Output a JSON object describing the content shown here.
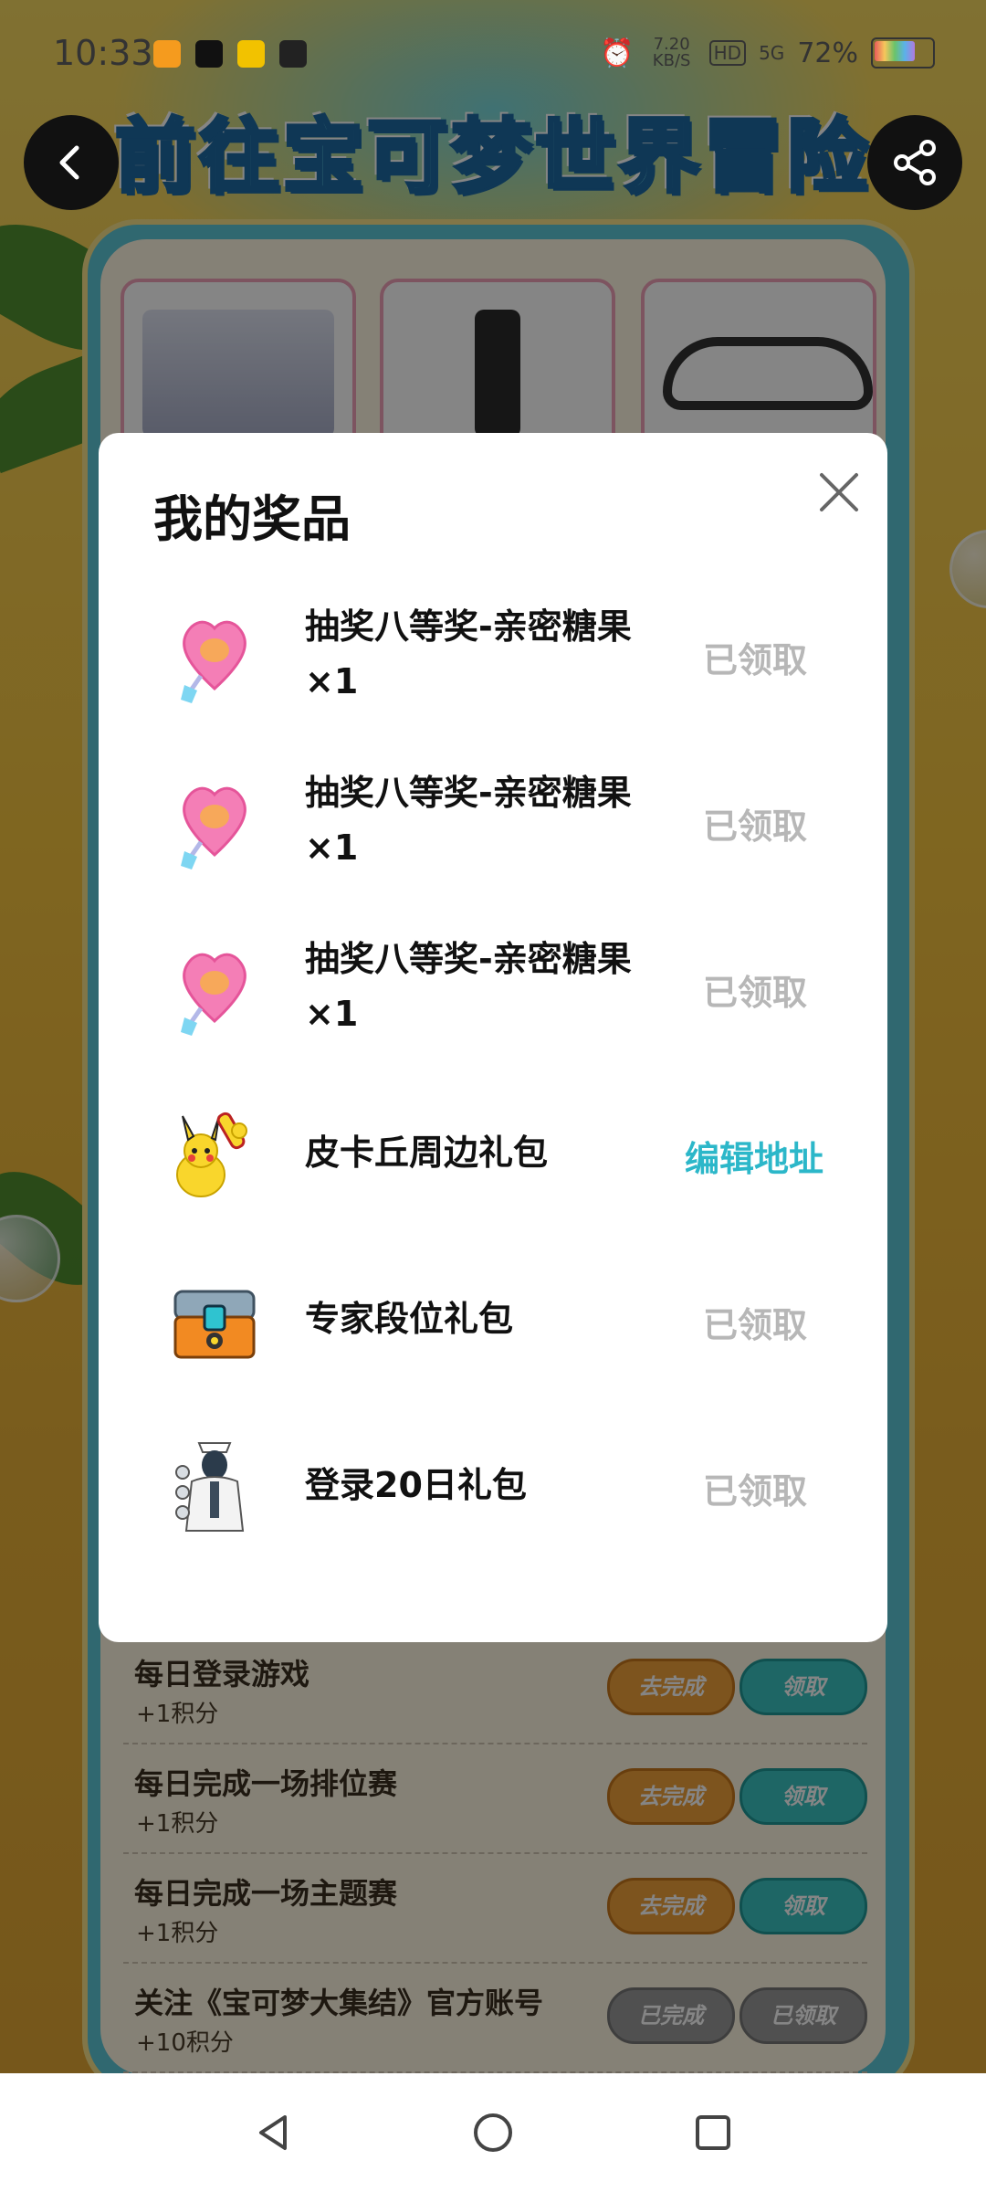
{
  "status_bar": {
    "time": "10:33",
    "net_speed": "7.20 KB/S",
    "hd": "HD",
    "network": "5G",
    "battery": "72%"
  },
  "header": {
    "title": "前往宝可梦世界冒险",
    "back_icon": "chevron-left-icon",
    "share_icon": "share-icon"
  },
  "tasks": [
    {
      "name": "每日登录游戏",
      "points": "+1积分",
      "go": "去完成",
      "claim": "领取"
    },
    {
      "name": "每日完成一场排位赛",
      "points": "+1积分",
      "go": "去完成",
      "claim": "领取"
    },
    {
      "name": "每日完成一场主题赛",
      "points": "+1积分",
      "go": "去完成",
      "claim": "领取"
    },
    {
      "name": "关注《宝可梦大集结》官方账号",
      "points": "+10积分",
      "go": "已完成",
      "claim": "已领取"
    }
  ],
  "modal": {
    "title": "我的奖品",
    "close_icon": "close-icon",
    "items": [
      {
        "name": "抽奖八等奖-亲密糖果×1",
        "status": "已领取",
        "icon": "lollipop-icon"
      },
      {
        "name": "抽奖八等奖-亲密糖果×1",
        "status": "已领取",
        "icon": "lollipop-icon"
      },
      {
        "name": "抽奖八等奖-亲密糖果×1",
        "status": "已领取",
        "icon": "lollipop-icon"
      },
      {
        "name": "皮卡丘周边礼包",
        "status": "编辑地址",
        "icon": "pikachu-icon"
      },
      {
        "name": "专家段位礼包",
        "status": "已领取",
        "icon": "chest-icon"
      },
      {
        "name": "登录20日礼包",
        "status": "已领取",
        "icon": "costume-icon"
      }
    ]
  },
  "colors": {
    "accent": "#2cb7c9",
    "muted": "#b7b7b7"
  }
}
